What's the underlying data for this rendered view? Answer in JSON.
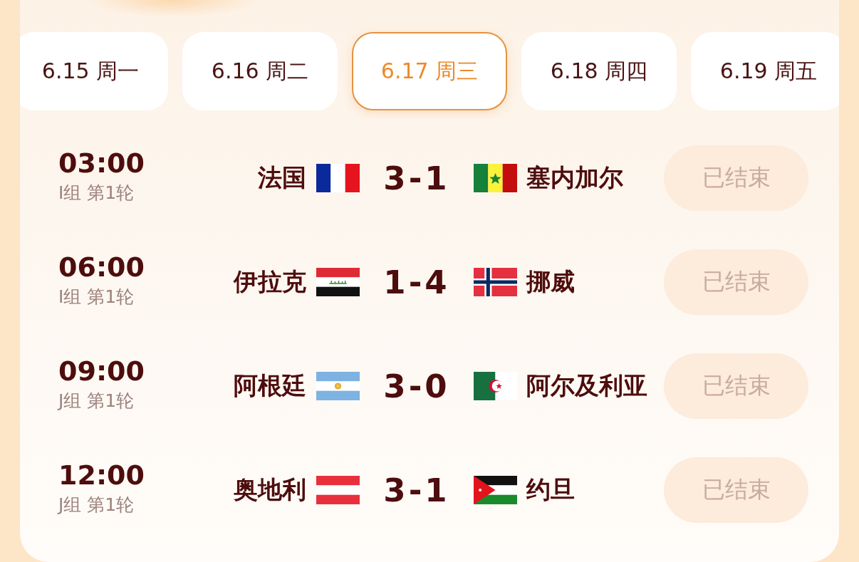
{
  "date_tabs": [
    {
      "label": "6.15 周一",
      "selected": false
    },
    {
      "label": "6.16 周二",
      "selected": false
    },
    {
      "label": "6.17 周三",
      "selected": true
    },
    {
      "label": "6.18 周四",
      "selected": false
    },
    {
      "label": "6.19 周五",
      "selected": false
    }
  ],
  "matches": [
    {
      "time": "03:00",
      "stage": "I组 第1轮",
      "home_team": {
        "name": "法国",
        "kind": "fr"
      },
      "score": "3-1",
      "away_team": {
        "name": "塞内加尔",
        "kind": "sn"
      },
      "status": {
        "label": "已结束",
        "disabled": true
      }
    },
    {
      "time": "06:00",
      "stage": "I组 第1轮",
      "home_team": {
        "name": "伊拉克",
        "kind": "iq"
      },
      "score": "1-4",
      "away_team": {
        "name": "挪威",
        "kind": "no"
      },
      "status": {
        "label": "已结束",
        "disabled": true
      }
    },
    {
      "time": "09:00",
      "stage": "J组 第1轮",
      "home_team": {
        "name": "阿根廷",
        "kind": "ar"
      },
      "score": "3-0",
      "away_team": {
        "name": "阿尔及利亚",
        "kind": "dz"
      },
      "status": {
        "label": "已结束",
        "disabled": true
      }
    },
    {
      "time": "12:00",
      "stage": "J组 第1轮",
      "home_team": {
        "name": "奥地利",
        "kind": "at"
      },
      "score": "3-1",
      "away_team": {
        "name": "约旦",
        "kind": "jo"
      },
      "status": {
        "label": "已结束",
        "disabled": true
      }
    }
  ]
}
